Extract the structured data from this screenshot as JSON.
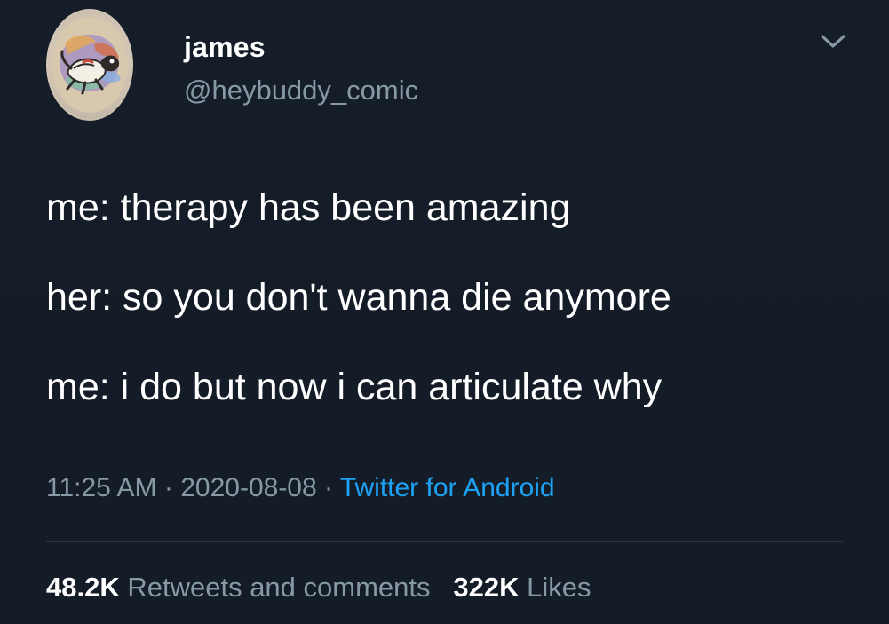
{
  "tweet": {
    "user": {
      "name": "james",
      "handle": "@heybuddy_comic"
    },
    "menu_icon": "chevron-down-icon",
    "lines": [
      "me: therapy has been amazing",
      "her: so you don't wanna die anymore",
      "me: i do but now i can articulate why"
    ],
    "meta": {
      "time": "11:25 AM",
      "separator": "·",
      "date": "2020-08-08",
      "source": "Twitter for Android"
    },
    "stats": {
      "retweets_count": "48.2K",
      "retweets_label": "Retweets and comments",
      "likes_count": "322K",
      "likes_label": "Likes"
    }
  },
  "colors": {
    "background": "#15202b",
    "text_primary": "#ffffff",
    "text_secondary": "#8899a6",
    "link": "#1da1f2"
  }
}
